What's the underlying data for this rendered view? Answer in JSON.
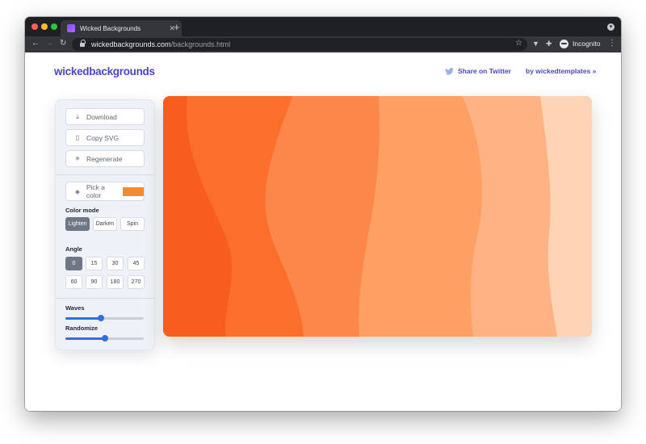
{
  "browser": {
    "tab_title": "Wicked Backgrounds",
    "tab_close": "✕",
    "new_tab": "+",
    "url_host": "wickedbackgrounds.com",
    "url_path": "/backgrounds.html",
    "incognito_label": "Incognito"
  },
  "header": {
    "logo": "wickedbackgrounds",
    "share_label": "Share on Twitter",
    "byline": "by wickedtemplates »"
  },
  "panel": {
    "download_label": "Download",
    "copy_label": "Copy SVG",
    "regenerate_label": "Regenerate",
    "pick_color_label": "Pick a color",
    "picked_color": "#f08a33",
    "color_mode_label": "Color mode",
    "color_modes": [
      "Lighten",
      "Darken",
      "Spin"
    ],
    "active_color_mode": "Lighten",
    "angle_label": "Angle",
    "angles": [
      "0",
      "15",
      "30",
      "45",
      "60",
      "90",
      "180",
      "270"
    ],
    "active_angle": "0",
    "waves_label": "Waves",
    "waves_value": 0.45,
    "randomize_label": "Randomize",
    "randomize_value": 0.5
  },
  "preview": {
    "colors": [
      "#f75d1f",
      "#fb6e2c",
      "#fd874a",
      "#fea064",
      "#ffb283",
      "#ffd4b4"
    ]
  }
}
